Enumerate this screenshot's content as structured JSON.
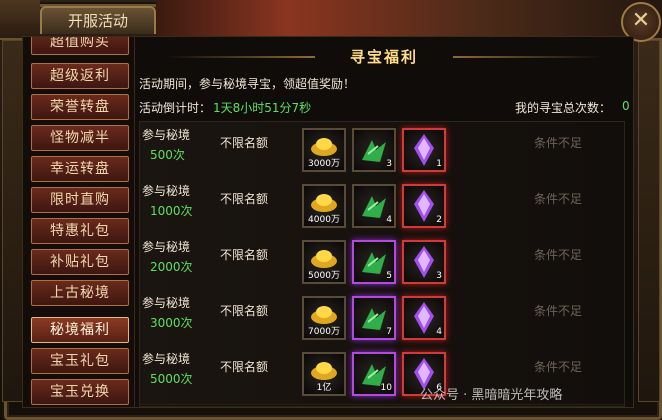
{
  "window": {
    "title": "开服活动",
    "close_icon": "close-icon"
  },
  "sidebar": {
    "items": [
      {
        "label": "超值购买",
        "active": false
      },
      {
        "label": "超级返利",
        "active": false
      },
      {
        "label": "荣誉转盘",
        "active": false
      },
      {
        "label": "怪物减半",
        "active": false
      },
      {
        "label": "幸运转盘",
        "active": false
      },
      {
        "label": "限时直购",
        "active": false
      },
      {
        "label": "特惠礼包",
        "active": false
      },
      {
        "label": "补贴礼包",
        "active": false
      },
      {
        "label": "上古秘境",
        "active": false
      },
      {
        "label": "秘境福利",
        "active": true
      },
      {
        "label": "宝玉礼包",
        "active": false
      },
      {
        "label": "宝玉兑换",
        "active": false
      }
    ]
  },
  "main": {
    "title": "寻宝福利",
    "description": "活动期间，参与秘境寻宝，领超值奖励！",
    "countdown_label": "活动倒计时：",
    "countdown_value": "1天8小时51分7秒",
    "total_label": "我的寻宝总次数：",
    "total_value": "0",
    "rows": [
      {
        "req_label": "参与秘境",
        "req_count": "500次",
        "limit": "不限名额",
        "rewards": [
          {
            "icon": "gold-ingot-icon",
            "qty": "3000万"
          },
          {
            "icon": "jade-herb-icon",
            "qty": "3"
          },
          {
            "icon": "purple-crystal-icon",
            "qty": "1"
          }
        ],
        "status": "条件不足"
      },
      {
        "req_label": "参与秘境",
        "req_count": "1000次",
        "limit": "不限名额",
        "rewards": [
          {
            "icon": "gold-ingot-icon",
            "qty": "4000万"
          },
          {
            "icon": "jade-herb-icon",
            "qty": "4"
          },
          {
            "icon": "purple-crystal-icon",
            "qty": "2"
          }
        ],
        "status": "条件不足"
      },
      {
        "req_label": "参与秘境",
        "req_count": "2000次",
        "limit": "不限名额",
        "rewards": [
          {
            "icon": "gold-ingot-icon",
            "qty": "5000万"
          },
          {
            "icon": "jade-herb-icon",
            "qty": "5"
          },
          {
            "icon": "purple-crystal-icon",
            "qty": "3"
          }
        ],
        "status": "条件不足"
      },
      {
        "req_label": "参与秘境",
        "req_count": "3000次",
        "limit": "不限名额",
        "rewards": [
          {
            "icon": "gold-ingot-icon",
            "qty": "7000万"
          },
          {
            "icon": "jade-herb-icon",
            "qty": "7"
          },
          {
            "icon": "purple-crystal-icon",
            "qty": "4"
          }
        ],
        "status": "条件不足"
      },
      {
        "req_label": "参与秘境",
        "req_count": "5000次",
        "limit": "不限名额",
        "rewards": [
          {
            "icon": "gold-ingot-icon",
            "qty": "1亿"
          },
          {
            "icon": "jade-herb-icon",
            "qty": "10"
          },
          {
            "icon": "purple-crystal-icon",
            "qty": "6"
          }
        ],
        "status": "条件不足"
      }
    ]
  },
  "watermark": "公众号 · 黑暗暗光年攻略",
  "colors": {
    "accent_green": "#5ee05e",
    "title_gold": "#ffdd88",
    "button_red": "#6a2a1c"
  }
}
